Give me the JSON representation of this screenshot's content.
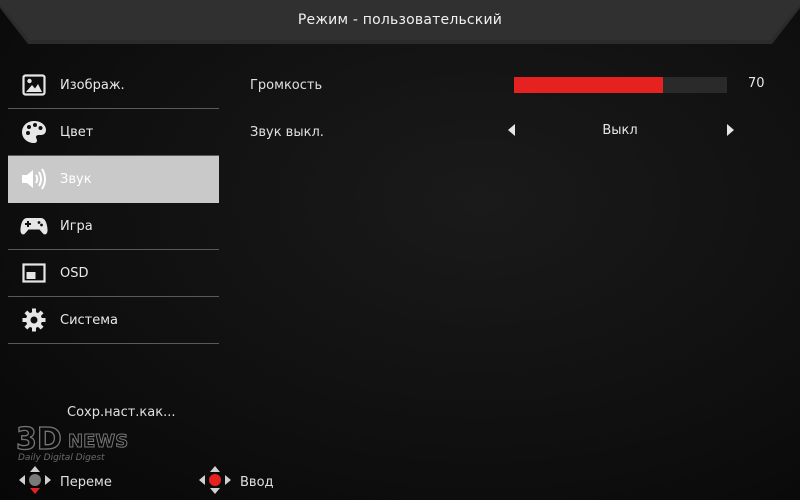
{
  "header": {
    "title": "Режим - пользовательский"
  },
  "sidebar": {
    "items": [
      {
        "label": "Изображ.",
        "icon": "image-icon"
      },
      {
        "label": "Цвет",
        "icon": "palette-icon"
      },
      {
        "label": "Звук",
        "icon": "speaker-icon",
        "active": true
      },
      {
        "label": "Игра",
        "icon": "gamepad-icon"
      },
      {
        "label": "OSD",
        "icon": "osd-window-icon"
      },
      {
        "label": "Система",
        "icon": "gear-icon"
      }
    ]
  },
  "content": {
    "volume": {
      "label": "Громкость",
      "value": 70,
      "value_text": "70"
    },
    "mute": {
      "label": "Звук выкл.",
      "value": "Выкл"
    }
  },
  "save_as": "Сохр.наст.как...",
  "hints": {
    "move": "Переме",
    "enter": "Ввод"
  },
  "watermark": {
    "logo": "3DNEWS",
    "tagline": "Daily Digital Digest"
  },
  "colors": {
    "accent": "#e5221f",
    "active_item": "#c9c9c9",
    "background": "#0b0b0b"
  }
}
